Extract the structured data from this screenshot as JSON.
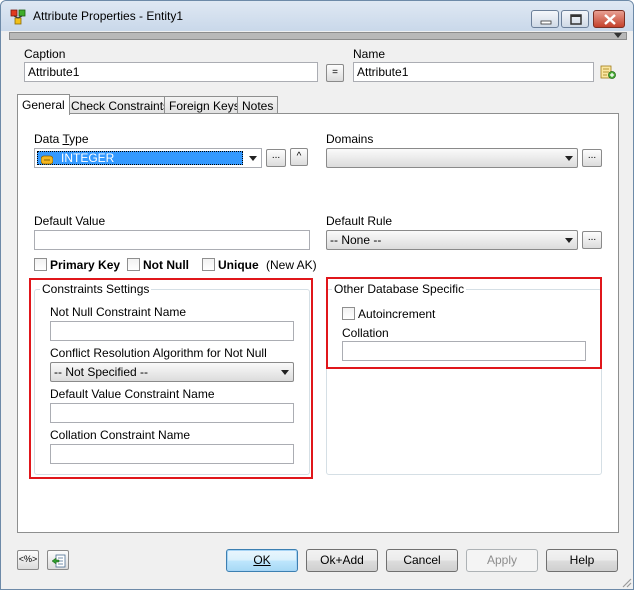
{
  "window": {
    "title": "Attribute Properties - Entity1"
  },
  "caption": {
    "label": "Caption",
    "value": "Attribute1",
    "equal_button": "="
  },
  "name": {
    "label": "Name",
    "value": "Attribute1"
  },
  "tabs": [
    {
      "label": "General"
    },
    {
      "label": "Check Constraints"
    },
    {
      "label": "Foreign Keys"
    },
    {
      "label": "Notes"
    }
  ],
  "general": {
    "data_type": {
      "label_pre": "Data ",
      "label_u": "T",
      "label_post": "ype",
      "value": "INTEGER",
      "more_button": "...",
      "up_button": "^"
    },
    "domains": {
      "label": "Domains",
      "value": "",
      "more_button": "..."
    },
    "default_value": {
      "label": "Default Value",
      "value": ""
    },
    "default_rule": {
      "label": "Default Rule",
      "value": "-- None --",
      "more_button": "..."
    },
    "checkboxes": {
      "primary_key": "Primary Key",
      "not_null": "Not Null",
      "unique": "Unique",
      "new_ak": "(New AK)"
    },
    "constraints_settings": {
      "title": "Constraints Settings",
      "not_null_name_label": "Not Null Constraint Name",
      "conflict_label": "Conflict Resolution Algorithm for Not Null",
      "conflict_value": "-- Not Specified --",
      "default_value_name_label": "Default Value Constraint Name",
      "collation_name_label": "Collation Constraint Name"
    },
    "other_db": {
      "title": "Other Database Specific",
      "autoincrement": "Autoincrement",
      "collation_label": "Collation",
      "collation_value": ""
    }
  },
  "footer": {
    "ok": "OK",
    "ok_add": "Ok+Add",
    "cancel": "Cancel",
    "apply": "Apply",
    "help": "Help",
    "icon_left_text": "<%>"
  }
}
